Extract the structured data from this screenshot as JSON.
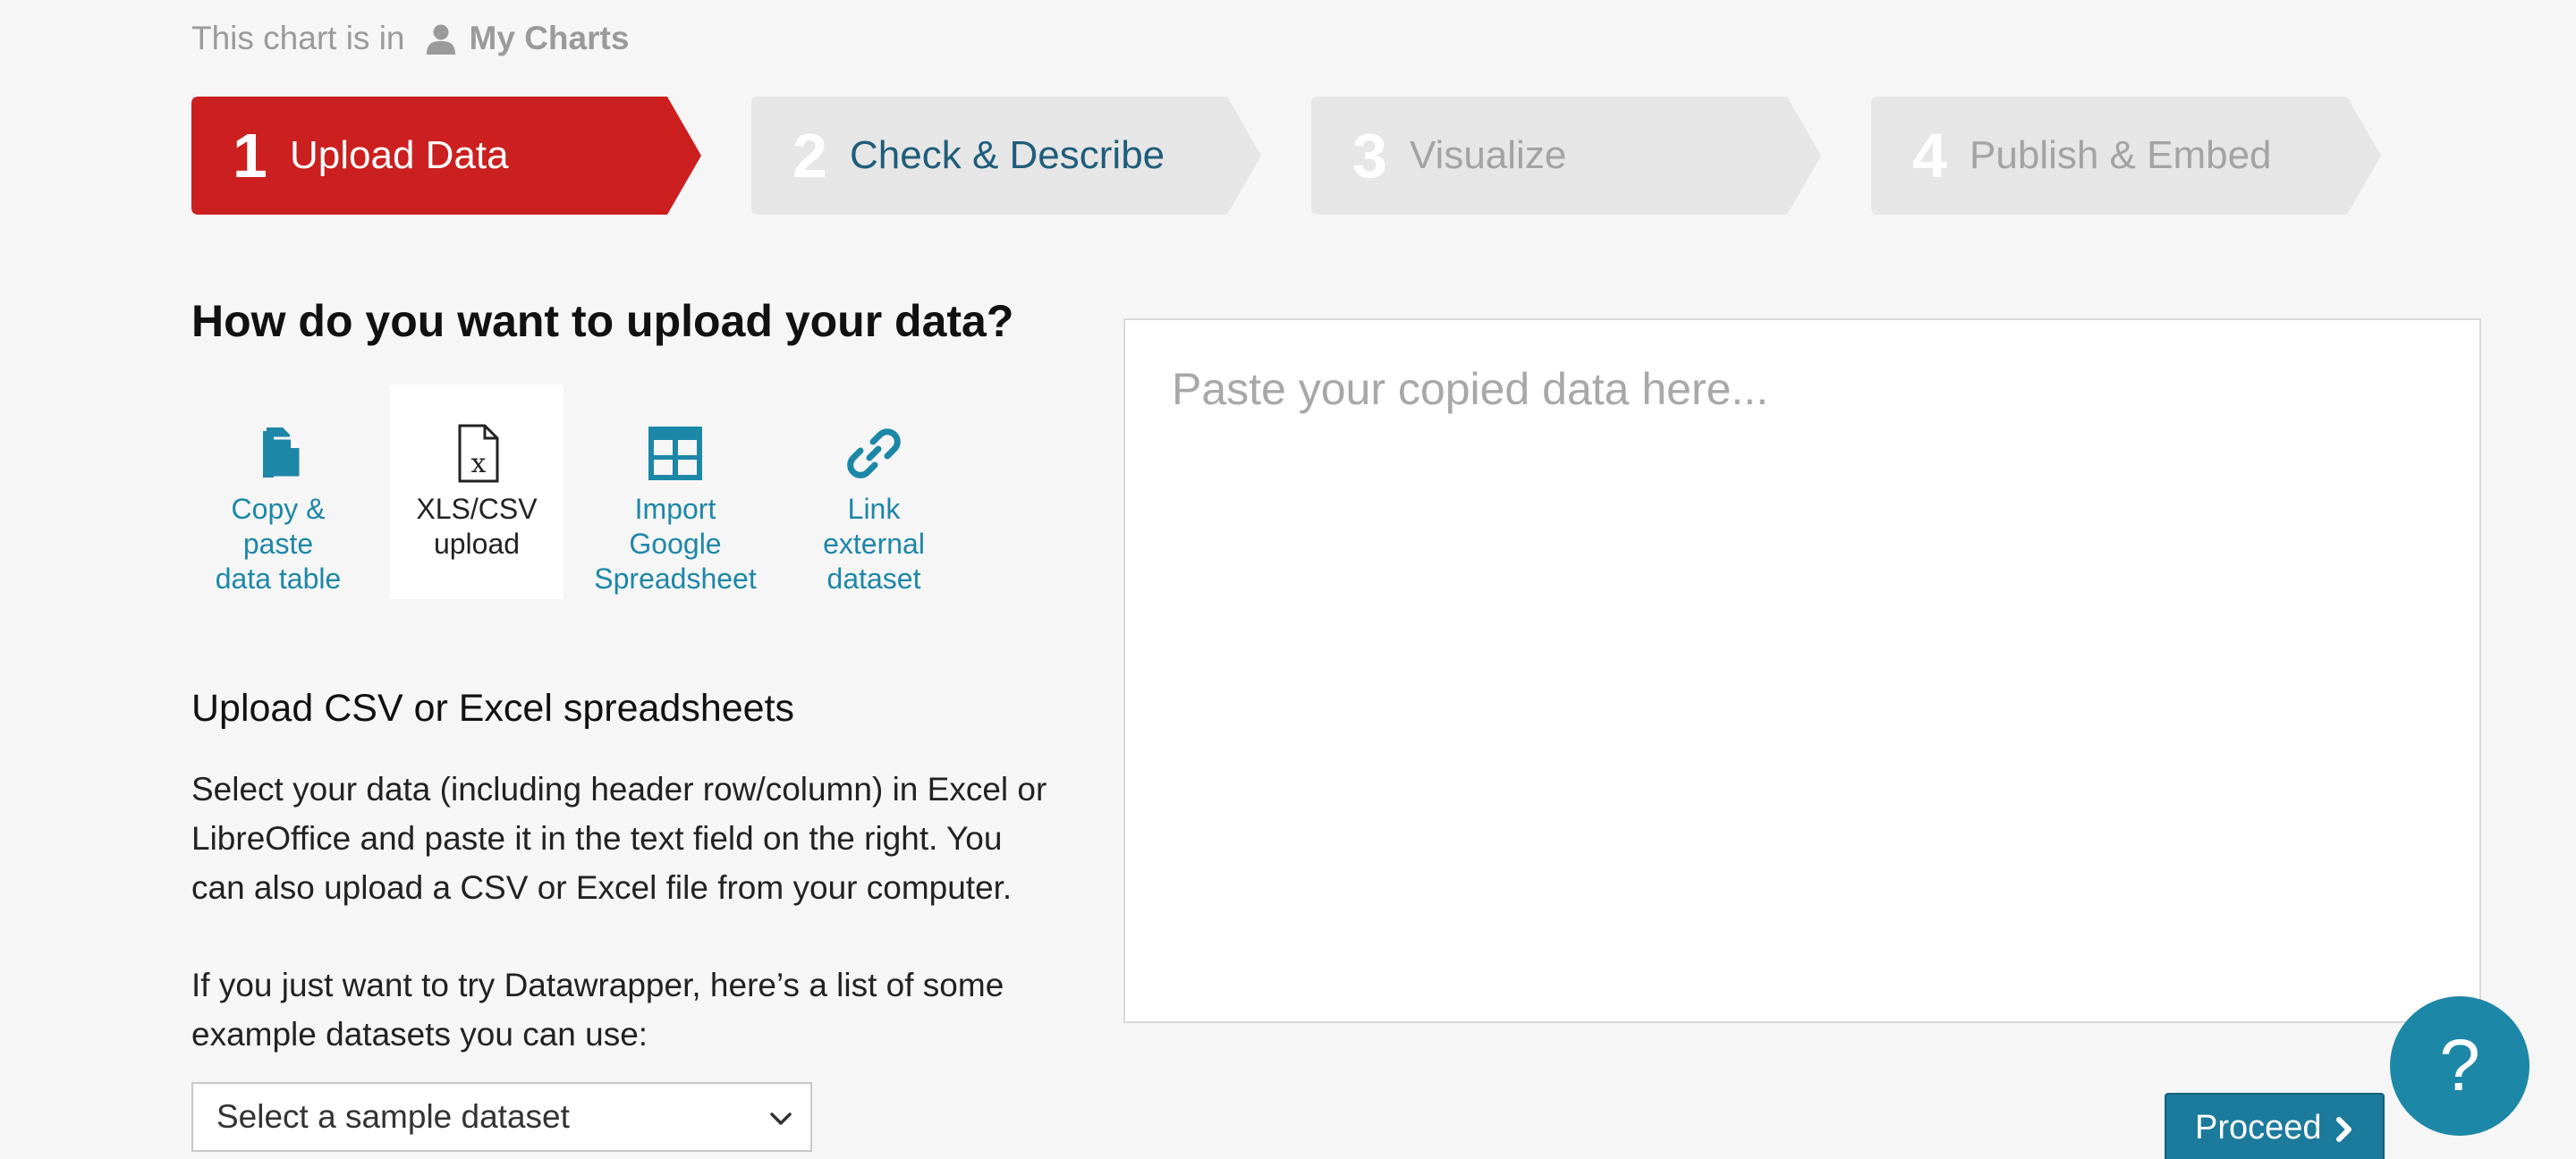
{
  "breadcrumb": {
    "prefix": "This chart is in",
    "folder": "My Charts",
    "icon": "user-icon"
  },
  "steps": [
    {
      "number": "1",
      "label": "Upload Data",
      "state": "active"
    },
    {
      "number": "2",
      "label": "Check & Describe",
      "state": "next"
    },
    {
      "number": "3",
      "label": "Visualize",
      "state": "disabled"
    },
    {
      "number": "4",
      "label": "Publish & Embed",
      "state": "disabled"
    }
  ],
  "colors": {
    "active_step": "#cc1f1f",
    "inactive_step": "#e6e6e6",
    "accent": "#1d87a8"
  },
  "upload": {
    "heading": "How do you want to upload your data?",
    "methods": [
      {
        "label": "Copy &\npaste\ndata table",
        "icon": "copy-paste-icon"
      },
      {
        "label": "XLS/CSV\nupload",
        "icon": "excel-file-icon",
        "selected": true
      },
      {
        "label": "Import\nGoogle\nSpreadsheet",
        "icon": "spreadsheet-grid-icon"
      },
      {
        "label": "Link\nexternal\ndataset",
        "icon": "link-icon"
      }
    ],
    "sub_heading": "Upload CSV or Excel spreadsheets",
    "description": "Select your data (including header row/column) in Excel or LibreOffice and paste it in the text field on the right. You can also upload a CSV or Excel file from your computer.",
    "sample_intro": "If you just want to try Datawrapper, here’s a list of some example datasets you can use:",
    "sample_select": "Select a sample dataset"
  },
  "paste": {
    "placeholder": "Paste your copied data here..."
  },
  "help": {
    "label": "?"
  },
  "proceed": {
    "label": "Proceed"
  }
}
